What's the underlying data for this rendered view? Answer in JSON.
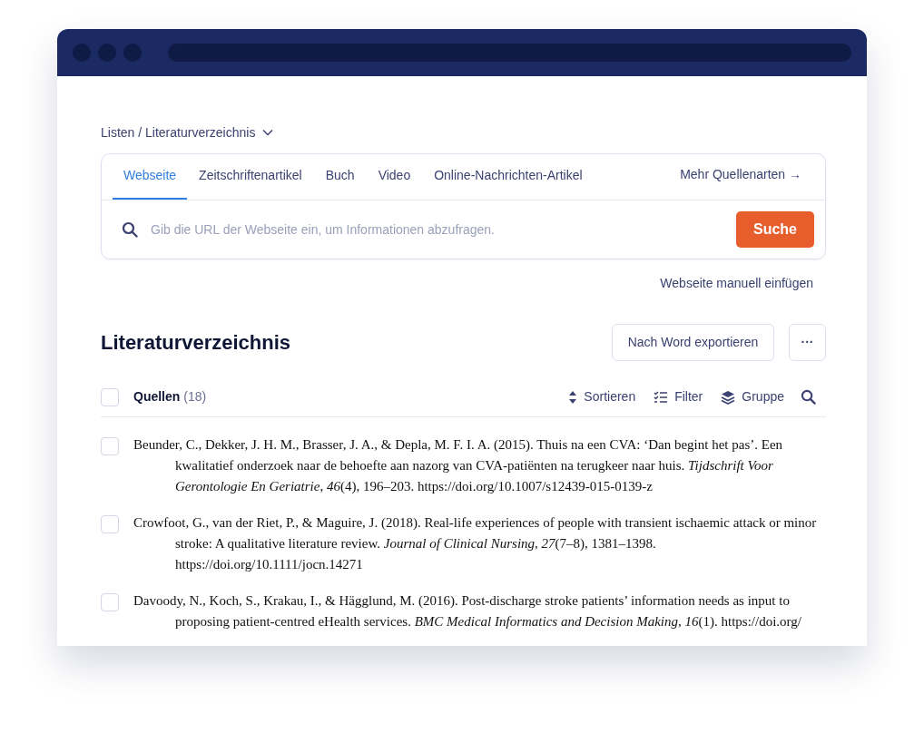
{
  "breadcrumb": {
    "label": "Listen / Literaturverzeichnis"
  },
  "source_tabs": [
    {
      "label": "Webseite",
      "selected": true
    },
    {
      "label": "Zeitschriftenartikel",
      "selected": false
    },
    {
      "label": "Buch",
      "selected": false
    },
    {
      "label": "Video",
      "selected": false
    },
    {
      "label": "Online-Nachrichten-Artikel",
      "selected": false
    }
  ],
  "more_sources": "Mehr Quellenarten →",
  "search": {
    "placeholder": "Gib die URL der Webseite ein, um Informationen abzufragen.",
    "button": "Suche"
  },
  "manual_link": "Webseite manuell einfügen",
  "heading": "Literaturverzeichnis",
  "export_button": "Nach Word exportieren",
  "more_button": "···",
  "toolbar": {
    "select_all_checked": false,
    "label": "Quellen",
    "count": "(18)",
    "actions": [
      "Sortieren",
      "Filter",
      "Gruppe"
    ]
  },
  "references": [
    {
      "checked": false,
      "text": "Beunder, C., Dekker, J. H. M., Brasser, J. A., & Depla, M. F. I. A. (2015). Thuis na een CVA: ‘Dan begint het pas’. Een kwalitatief onderzoek naar de behoefte aan nazorg van CVA-patiënten na terugkeer naar huis. *Tijdschrift Voor Gerontologie En Geriatrie*, *46*(4), 196–203. https://doi.org/10.1007/s12439-015-0139-z"
    },
    {
      "checked": false,
      "text": "Crowfoot, G., van der Riet, P., & Maguire, J. (2018). Real-life experiences of people with transient ischaemic attack or minor stroke: A qualitative literature review. *Journal of Clinical Nursing*, *27*(7–8), 1381–1398. https://doi.org/10.1111/jocn.14271"
    },
    {
      "checked": false,
      "text": "Davoody, N., Koch, S., Krakau, I., & Hägglund, M. (2016). Post-discharge stroke patients’ information needs as input to proposing patient-centred eHealth services. *BMC Medical Informatics and Decision Making*, *16*(1). https://doi.org/"
    }
  ]
}
